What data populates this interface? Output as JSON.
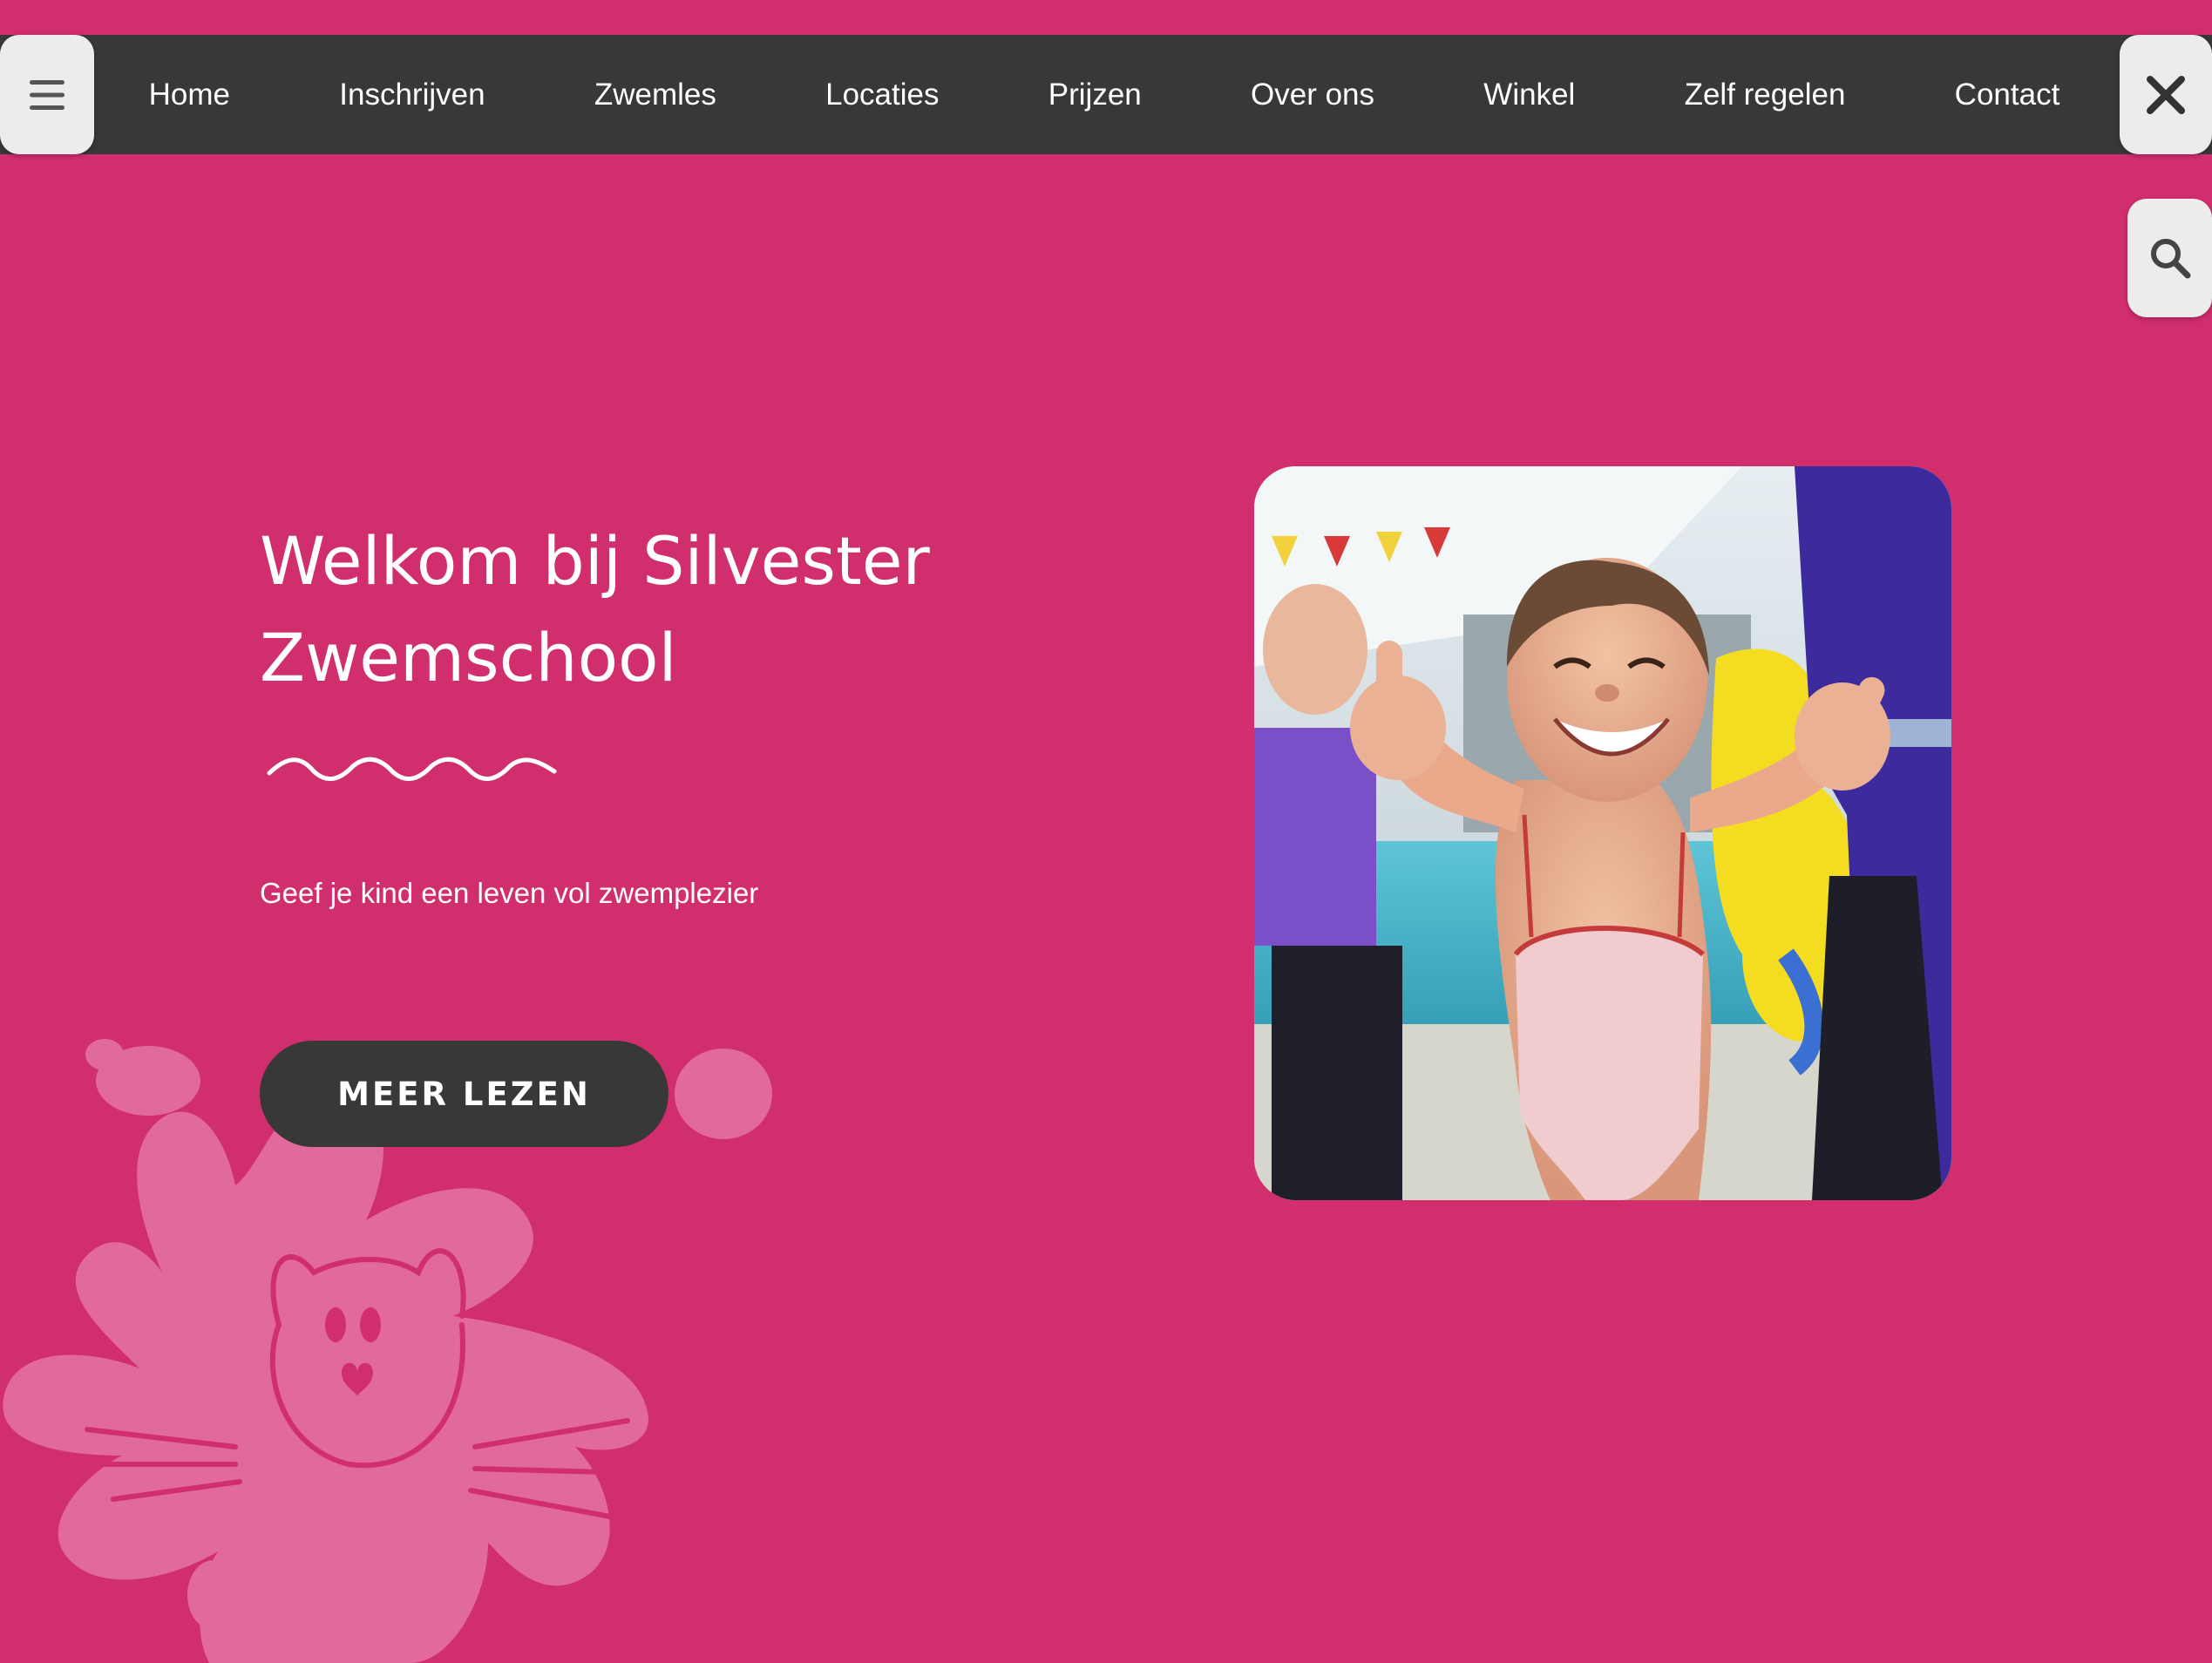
{
  "nav": {
    "items": [
      {
        "label": "Home"
      },
      {
        "label": "Inschrijven"
      },
      {
        "label": "Zwemles"
      },
      {
        "label": "Locaties"
      },
      {
        "label": "Prijzen"
      },
      {
        "label": "Over ons"
      },
      {
        "label": "Winkel"
      },
      {
        "label": "Zelf regelen"
      },
      {
        "label": "Contact"
      }
    ],
    "menu_icon": "hamburger-menu-icon",
    "close_icon": "close-icon",
    "search_icon": "search-icon"
  },
  "hero": {
    "title_line1": "Welkom bij Silvester",
    "title_line2": "Zwemschool",
    "tagline": "Geef je kind een leven vol zwemplezier",
    "cta_label": "MEER LEZEN",
    "photo_subject": "smiling child in swimsuit giving two thumbs up at a swimming pool"
  },
  "colors": {
    "background": "#d12e6e",
    "navbar": "#383838",
    "button": "#383838",
    "splash": "#e2699c",
    "text": "#ffffff"
  }
}
